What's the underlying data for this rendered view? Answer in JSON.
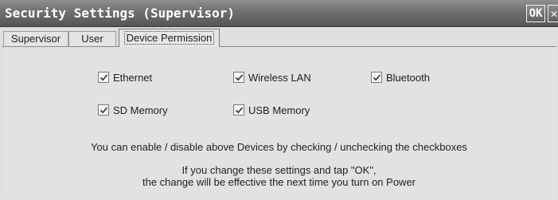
{
  "window": {
    "title": "Security Settings (Supervisor)",
    "ok_label": "OK",
    "close_label": "✕"
  },
  "tabs": [
    {
      "label": "Supervisor",
      "active": false
    },
    {
      "label": "User",
      "active": false
    },
    {
      "label": "Device Permission",
      "active": true
    }
  ],
  "devices": [
    {
      "label": "Ethernet",
      "checked": true
    },
    {
      "label": "Wireless LAN",
      "checked": true
    },
    {
      "label": "Bluetooth",
      "checked": true
    },
    {
      "label": "SD Memory",
      "checked": true
    },
    {
      "label": "USB Memory",
      "checked": true
    }
  ],
  "info": {
    "line1": "You can enable / disable above Devices by checking / unchecking the checkboxes",
    "line2": "If you change these settings and tap \"OK\",",
    "line3": "the change will be effective the next time you turn on Power"
  },
  "colors": {
    "titlebar": "#6f6f6f",
    "panel": "#e2e2e2",
    "check": "#333333"
  }
}
